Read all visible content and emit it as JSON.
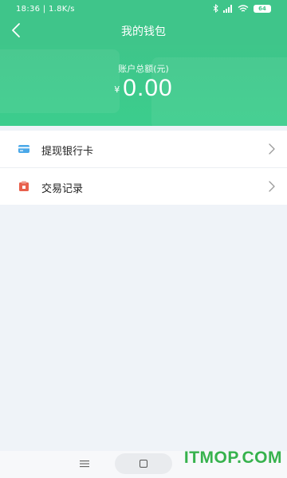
{
  "status_bar": {
    "time": "18:36 | 1.8K/s",
    "battery": "64",
    "icons": [
      "bluetooth-icon",
      "signal-icon",
      "wifi-icon",
      "battery-icon"
    ]
  },
  "header": {
    "title": "我的钱包",
    "back_icon": "chevron-left-icon"
  },
  "balance": {
    "label": "账户总额(元)",
    "currency": "¥",
    "amount": "0.00"
  },
  "menu": {
    "items": [
      {
        "label": "提现银行卡",
        "icon": "bank-card-icon",
        "icon_color": "#4aa8e8"
      },
      {
        "label": "交易记录",
        "icon": "transaction-record-icon",
        "icon_color": "#e8604c"
      }
    ]
  },
  "navigation": {
    "menu_icon": "hamburger-icon",
    "home_icon": "square-home-icon"
  },
  "watermark": "ITMOP.COM",
  "colors": {
    "brand": "#3fc58a",
    "background": "#eff3f8"
  }
}
